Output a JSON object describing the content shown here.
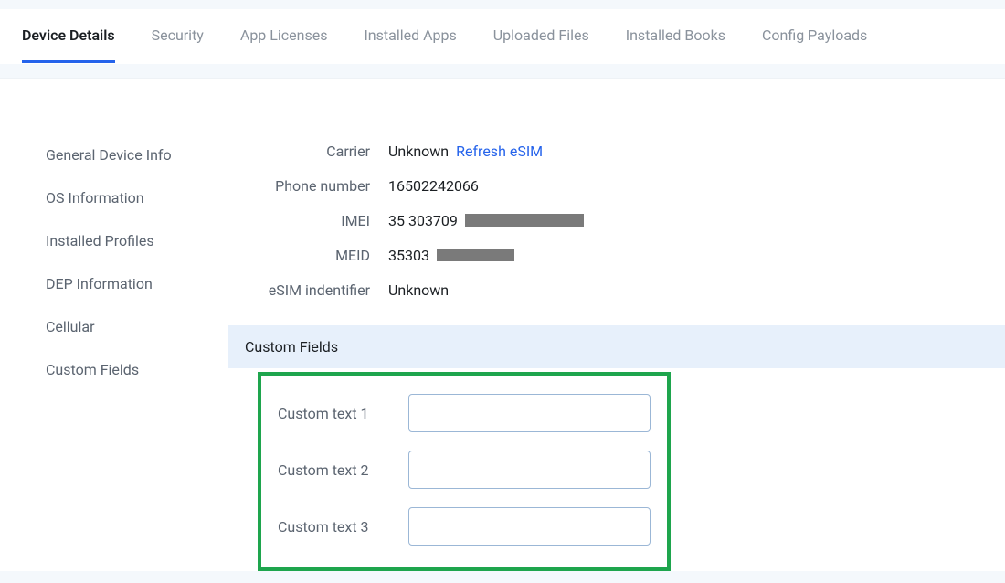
{
  "tabs": [
    {
      "label": "Device Details",
      "active": true
    },
    {
      "label": "Security",
      "active": false
    },
    {
      "label": "App Licenses",
      "active": false
    },
    {
      "label": "Installed Apps",
      "active": false
    },
    {
      "label": "Uploaded Files",
      "active": false
    },
    {
      "label": "Installed Books",
      "active": false
    },
    {
      "label": "Config Payloads",
      "active": false
    }
  ],
  "sidebar": {
    "items": [
      {
        "label": "General Device Info"
      },
      {
        "label": "OS Information"
      },
      {
        "label": "Installed Profiles"
      },
      {
        "label": "DEP Information"
      },
      {
        "label": "Cellular"
      },
      {
        "label": "Custom Fields"
      }
    ]
  },
  "cellular": {
    "carrier_label": "Carrier",
    "carrier_value": "Unknown",
    "refresh_esim": "Refresh eSIM",
    "phone_label": "Phone number",
    "phone_value": "16502242066",
    "imei_label": "IMEI",
    "imei_value": "35 303709",
    "meid_label": "MEID",
    "meid_value": "35303",
    "esim_ident_label": "eSIM indentifier",
    "esim_ident_value": "Unknown"
  },
  "custom_fields": {
    "heading": "Custom Fields",
    "rows": [
      {
        "label": "Custom text 1",
        "value": ""
      },
      {
        "label": "Custom text 2",
        "value": ""
      },
      {
        "label": "Custom text 3",
        "value": ""
      }
    ]
  }
}
